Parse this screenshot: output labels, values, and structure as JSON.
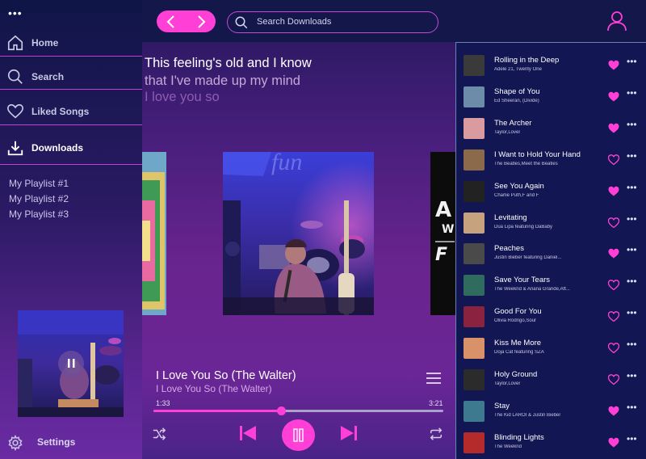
{
  "colors": {
    "accent": "#ff3fd5",
    "sidebar_line": "#c73fd0",
    "bg_dark": "#13174a"
  },
  "sidebar": {
    "menu_icon": "more-horizontal-icon",
    "nav": [
      {
        "label": "Home",
        "icon": "home-icon"
      },
      {
        "label": "Search",
        "icon": "search-icon"
      },
      {
        "label": "Liked Songs",
        "icon": "heart-icon"
      },
      {
        "label": "Downloads",
        "icon": "download-icon",
        "active": true
      }
    ],
    "playlists": [
      "My Playlist #1",
      "My Playlist #2",
      "My Playlist #3"
    ],
    "settings_label": "Settings"
  },
  "topbar": {
    "search_placeholder": "Search Downloads",
    "back_icon": "chevron-left-icon",
    "forward_icon": "chevron-right-icon",
    "user_icon": "user-icon"
  },
  "lyrics": [
    "This feeling's old and I know",
    "that I've made up my mind",
    "I love you so"
  ],
  "now_playing": {
    "title": "I Love You So (The Walter)",
    "artist": "I Love You So (The Walter)",
    "current_time": "1:33",
    "total_time": "3:21",
    "progress": 0.44
  },
  "songs": [
    {
      "title": "Rolling in the Deep",
      "artist": "Adele 21, Twenty One",
      "liked": true,
      "thumb": "#3a3a3a"
    },
    {
      "title": "Shape of You",
      "artist": "Ed Sheeran, (Divide)",
      "liked": true,
      "thumb": "#6d8caa"
    },
    {
      "title": "The Archer",
      "artist": "Taylor,Lover",
      "liked": true,
      "thumb": "#d99aa0"
    },
    {
      "title": "I Want to Hold Your Hand",
      "artist": "The Beatles,Meet the Beatles",
      "liked": false,
      "thumb": "#8a6a4a"
    },
    {
      "title": "See You Again",
      "artist": "Charlie Puth,F and F",
      "liked": true,
      "thumb": "#222222"
    },
    {
      "title": "Levitating",
      "artist": "Dua Lipa featuring DaBaby",
      "liked": false,
      "thumb": "#c6a37e"
    },
    {
      "title": "Peaches",
      "artist": "Justin Bieber featuring Daniel...",
      "liked": true,
      "thumb": "#4a4a4a"
    },
    {
      "title": "Save Your Tears",
      "artist": "The Weeknd & Ariana Grande,Aft...",
      "liked": false,
      "thumb": "#2f6b5e"
    },
    {
      "title": "Good For You",
      "artist": "Olivia Rodrigo,Sour",
      "liked": false,
      "thumb": "#8a2240"
    },
    {
      "title": "Kiss Me More",
      "artist": "Doja Cat featuring SZA",
      "liked": false,
      "thumb": "#d9916a"
    },
    {
      "title": "Holy Ground",
      "artist": "Taylor,Lover",
      "liked": false,
      "thumb": "#2b2b2b"
    },
    {
      "title": "Stay",
      "artist": "The Kid LAROI & Justin Bieber",
      "liked": true,
      "thumb": "#3d7a8f"
    },
    {
      "title": "Blinding Lights",
      "artist": "The Weeknd",
      "liked": true,
      "thumb": "#b52a2a"
    }
  ]
}
